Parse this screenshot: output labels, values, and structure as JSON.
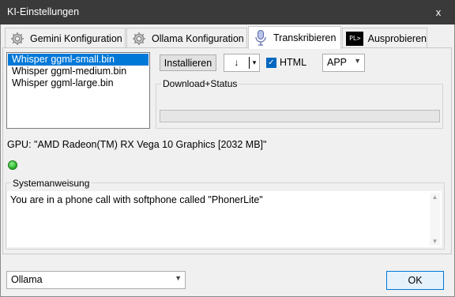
{
  "window": {
    "title": "KI-Einstellungen",
    "close_glyph": "x"
  },
  "tabs": [
    {
      "label": "Gemini Konfiguration",
      "icon": "gear-icon"
    },
    {
      "label": "Ollama Konfiguration",
      "icon": "gear-icon"
    },
    {
      "label": "Transkribieren",
      "icon": "microphone-icon",
      "active": true
    },
    {
      "label": "Ausprobieren",
      "icon": "terminal-icon",
      "icon_text": "PL>"
    }
  ],
  "models": {
    "items": [
      "Whisper ggml-small.bin",
      "Whisper ggml-medium.bin",
      "Whisper ggml-large.bin"
    ],
    "selected": "Whisper ggml-small.bin"
  },
  "toolbar": {
    "install_label": "Installieren",
    "download_glyph": "↓",
    "dropdown_glyph": "▾",
    "html_label": "HTML",
    "html_checked": true,
    "target_value": "APP"
  },
  "download": {
    "legend": "Download+Status",
    "progress": 0
  },
  "gpu_text": "GPU: \"AMD Radeon(TM) RX Vega 10 Graphics [2032 MB]\"",
  "status": {
    "color": "#2cb52c"
  },
  "system": {
    "legend": "Systemanweisung",
    "text": "You are in a phone call with softphone called \"PhonerLite\""
  },
  "footer": {
    "provider_value": "Ollama",
    "ok_label": "OK"
  },
  "colors": {
    "accent": "#0078d7",
    "titlebar": "#3a3a3a"
  }
}
